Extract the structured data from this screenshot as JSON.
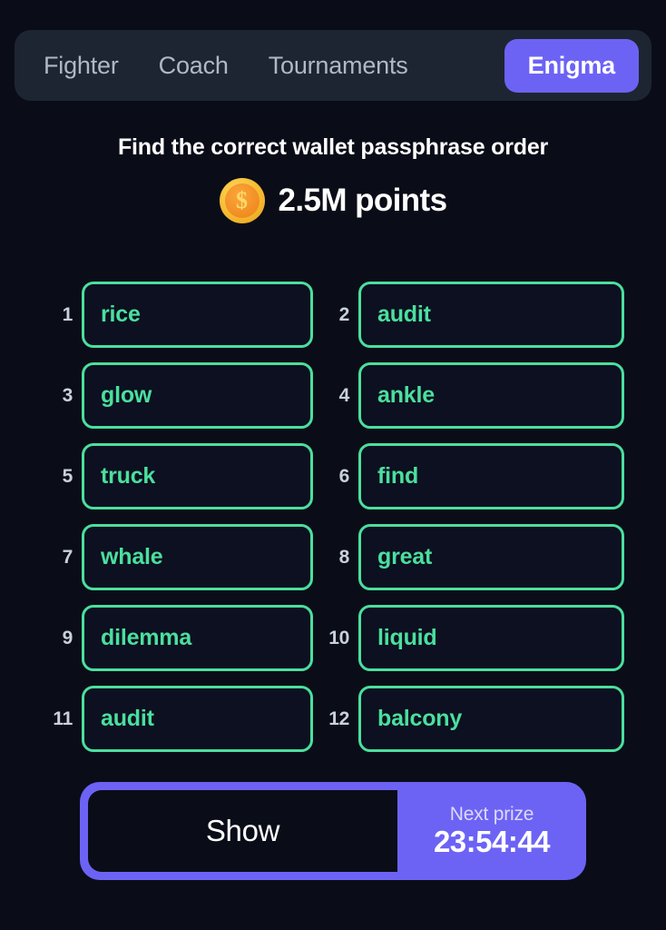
{
  "nav": {
    "tabs": [
      {
        "label": "Fighter",
        "active": false
      },
      {
        "label": "Coach",
        "active": false
      },
      {
        "label": "Tournaments",
        "active": false
      },
      {
        "label": "Enigma",
        "active": true
      }
    ]
  },
  "header": {
    "prompt": "Find the correct wallet passphrase order",
    "coin_icon": "gold-coin-dollar-icon",
    "coin_symbol": "$",
    "points": "2.5M points"
  },
  "words": [
    {
      "index": "1",
      "word": "rice"
    },
    {
      "index": "2",
      "word": "audit"
    },
    {
      "index": "3",
      "word": "glow"
    },
    {
      "index": "4",
      "word": "ankle"
    },
    {
      "index": "5",
      "word": "truck"
    },
    {
      "index": "6",
      "word": "find"
    },
    {
      "index": "7",
      "word": "whale"
    },
    {
      "index": "8",
      "word": "great"
    },
    {
      "index": "9",
      "word": "dilemma"
    },
    {
      "index": "10",
      "word": "liquid"
    },
    {
      "index": "11",
      "word": "audit"
    },
    {
      "index": "12",
      "word": "balcony"
    }
  ],
  "footer": {
    "show_label": "Show",
    "prize_label": "Next prize",
    "prize_timer": "23:54:44"
  },
  "colors": {
    "background": "#0a0d18",
    "navbar": "#1e2532",
    "accent_purple": "#6c63f5",
    "word_green": "#4bdf9e",
    "inactive_tab": "#b0b7c6",
    "index_grey": "#c9d0dd",
    "coin_gold": "#f6bc33",
    "coin_orange": "#f08c22"
  }
}
